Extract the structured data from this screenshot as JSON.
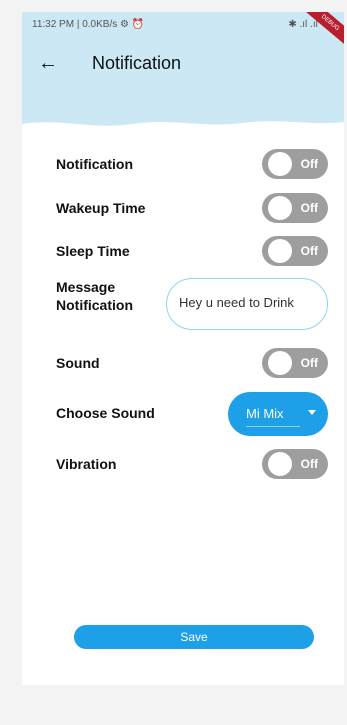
{
  "status_bar": {
    "time_text": "11:32 PM | 0.0KB/s ⚙ ⏰",
    "icons_text": "✱ .ıl .ıl ⌔"
  },
  "debug_ribbon": "DEBUG",
  "header": {
    "back_icon": "arrow-left-icon",
    "title": "Notification"
  },
  "settings": {
    "notification": {
      "label": "Notification",
      "toggle": "Off"
    },
    "wakeup_time": {
      "label": "Wakeup Time",
      "toggle": "Off"
    },
    "sleep_time": {
      "label": "Sleep Time",
      "toggle": "Off"
    },
    "message_notification": {
      "label_line1": "Message",
      "label_line2": "Notification",
      "value": "Hey u need to Drink"
    },
    "sound": {
      "label": "Sound",
      "toggle": "Off"
    },
    "choose_sound": {
      "label": "Choose Sound",
      "value": "Mi Mix"
    },
    "vibration": {
      "label": "Vibration",
      "toggle": "Off"
    }
  },
  "save_label": "Save",
  "colors": {
    "accent": "#1ea0e8",
    "header_bg": "#cbe8f4",
    "toggle_off": "#9e9e9e"
  }
}
